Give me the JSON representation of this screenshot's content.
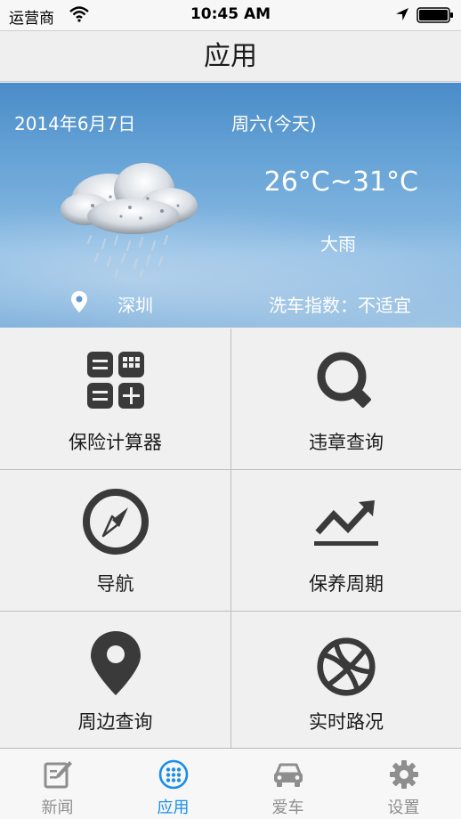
{
  "status_bar": {
    "carrier": "运营商",
    "time": "10:45 AM"
  },
  "header": {
    "title": "应用"
  },
  "weather": {
    "date": "2014年6月7日",
    "weekday": "周六(今天)",
    "temperature": "26°C~31°C",
    "condition": "大雨",
    "city": "深圳",
    "car_wash_index": "洗车指数：不适宜",
    "condition_icon": "cloud-rain-icon"
  },
  "tiles": [
    {
      "label": "保险计算器",
      "icon": "calculator-icon"
    },
    {
      "label": "违章查询",
      "icon": "search-icon"
    },
    {
      "label": "导航",
      "icon": "compass-icon"
    },
    {
      "label": "保养周期",
      "icon": "trend-chart-icon"
    },
    {
      "label": "周边查询",
      "icon": "map-pin-icon"
    },
    {
      "label": "实时路况",
      "icon": "basketball-icon"
    }
  ],
  "tab_bar": {
    "active_color": "#1a8ee8",
    "inactive_color": "#8e8e8e",
    "items": [
      {
        "label": "新闻",
        "icon": "news-edit-icon",
        "active": false
      },
      {
        "label": "应用",
        "icon": "apps-grid-icon",
        "active": true
      },
      {
        "label": "爱车",
        "icon": "car-icon",
        "active": false
      },
      {
        "label": "设置",
        "icon": "gear-icon",
        "active": false
      }
    ]
  }
}
